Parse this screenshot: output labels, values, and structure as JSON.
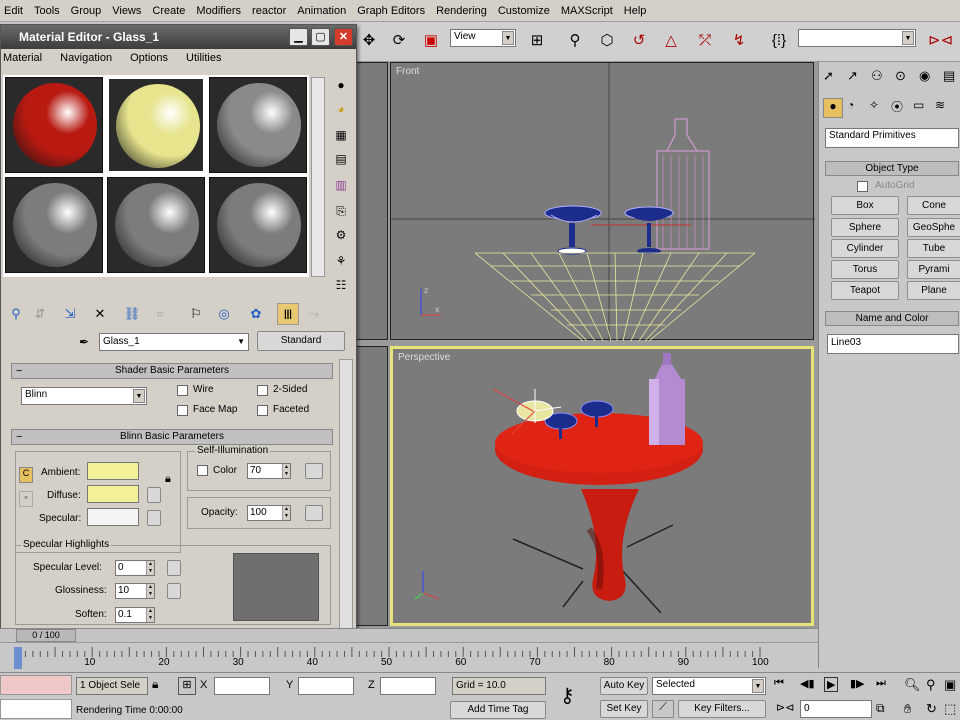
{
  "menu": [
    "Edit",
    "Tools",
    "Group",
    "Views",
    "Create",
    "Modifiers",
    "reactor",
    "Animation",
    "Graph Editors",
    "Rendering",
    "Customize",
    "MAXScript",
    "Help"
  ],
  "toolbar": {
    "ref_coord": "View",
    "selection_set": ""
  },
  "viewports": {
    "front_label": "Front",
    "perspective_label": "Perspective"
  },
  "material_editor": {
    "title": "Material Editor - Glass_1",
    "menu": [
      "Material",
      "Navigation",
      "Options",
      "Utilities"
    ],
    "slot_colors": [
      "#b81a12",
      "#e6e48c",
      "#8a8a8a",
      "#7c7c7c",
      "#7c7c7c",
      "#7c7c7c"
    ],
    "material_name": "Glass_1",
    "material_type": "Standard",
    "shader_rollout": "Shader Basic Parameters",
    "shader": "Blinn",
    "checks": {
      "wire": "Wire",
      "two_sided": "2-Sided",
      "face_map": "Face Map",
      "faceted": "Faceted"
    },
    "blinn_rollout": "Blinn Basic Parameters",
    "self_illum_group": "Self-Illumination",
    "color_label": "Color",
    "color_value": "70",
    "ambient_label": "Ambient:",
    "diffuse_label": "Diffuse:",
    "specular_label": "Specular:",
    "ambient_color": "#f2f098",
    "diffuse_color": "#f2f098",
    "specular_color": "#f4f4f4",
    "opacity_label": "Opacity:",
    "opacity_value": "100",
    "spec_group": "Specular Highlights",
    "spec_level_label": "Specular Level:",
    "spec_level_value": "0",
    "glossiness_label": "Glossiness:",
    "glossiness_value": "10",
    "soften_label": "Soften:",
    "soften_value": "0.1"
  },
  "command_panel": {
    "category": "Standard Primitives",
    "object_type_rollout": "Object Type",
    "autogrid": "AutoGrid",
    "buttons": [
      "Box",
      "Cone",
      "Sphere",
      "GeoSphe",
      "Cylinder",
      "Tube",
      "Torus",
      "Pyrami",
      "Teapot",
      "Plane"
    ],
    "name_color_rollout": "Name and Color",
    "object_name": "Line03"
  },
  "timeline": {
    "frame_readout": "0 / 100",
    "ticks": [
      "10",
      "20",
      "30",
      "40",
      "50",
      "60",
      "70",
      "80",
      "90",
      "100"
    ]
  },
  "status": {
    "selection": "1 Object Sele",
    "x_label": "X",
    "y_label": "Y",
    "z_label": "Z",
    "grid": "Grid = 10.0",
    "render_time": "Rendering Time  0:00:00",
    "add_time_tag": "Add Time Tag",
    "auto_key": "Auto Key",
    "selected": "Selected",
    "set_key": "Set Key",
    "key_filters": "Key Filters...",
    "frame": "0"
  }
}
